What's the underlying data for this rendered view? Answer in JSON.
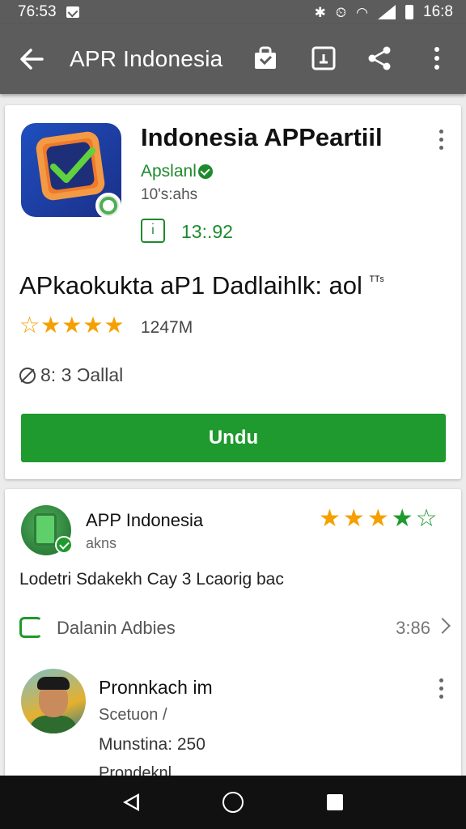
{
  "status_bar": {
    "time": "76:53",
    "clock": "16:8"
  },
  "app_bar": {
    "title": "APR Indonesia"
  },
  "app_card": {
    "name": "Indonesia APPeartiil",
    "developer": "Apslanl",
    "subtitle": "10's:ahs",
    "age_icon": "ı̇",
    "age_value": "13:.92",
    "headline": "APkaokukta aP1 Dadlaihlk: aol",
    "headline_sup": "ᵀᵀˢ",
    "rating_stars": 5,
    "rating_count": "1247M",
    "size_text": "8: 3 Ɔallal",
    "install_label": "Undu"
  },
  "review": {
    "name": "APP Indonesia",
    "sub": "akns",
    "stars_gold": 3,
    "stars_green": 1,
    "stars_outline": 1,
    "text": "Lodetri Sdakekh Cay 3 Lcaorig bac",
    "reply_label": "Dalanin Adbies",
    "reply_count": "3:86"
  },
  "user": {
    "name": "Pronnkach im",
    "sub": "Scetuon /",
    "meta": "Munstina: 250",
    "cut": "Prondeknl"
  },
  "colors": {
    "accent_green": "#1e9a2e",
    "bar_gray": "#5c5c5c",
    "star_gold": "#f5a000"
  },
  "icons": [
    "back-arrow-icon",
    "shopping-bag-icon",
    "cast-icon",
    "share-icon",
    "more-vert-icon",
    "verified-icon",
    "chevron-right-icon"
  ]
}
